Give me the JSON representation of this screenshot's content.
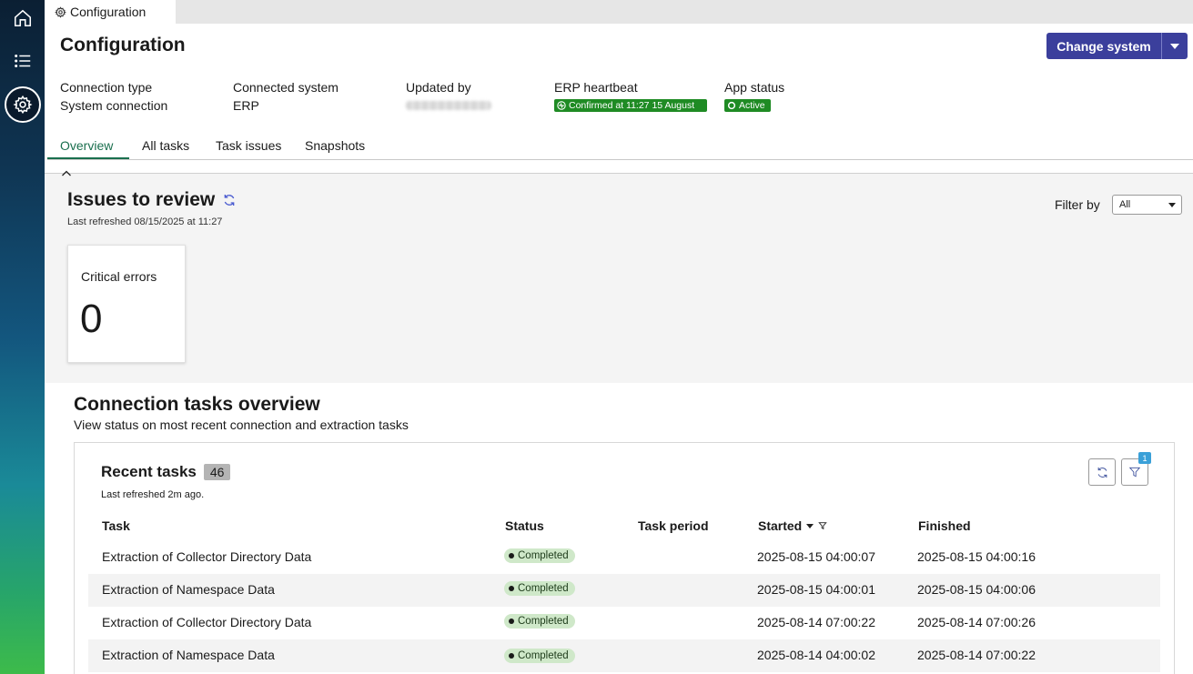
{
  "tab": {
    "label": "Configuration"
  },
  "header": {
    "title": "Configuration",
    "change_button": "Change system"
  },
  "meta": {
    "connection_type_label": "Connection type",
    "connection_type_value": "System connection",
    "connected_system_label": "Connected system",
    "connected_system_value": "ERP",
    "updated_by_label": "Updated by",
    "heartbeat_label": "ERP heartbeat",
    "heartbeat_value": "Confirmed at 11:27 15 August",
    "app_status_label": "App status",
    "app_status_value": "Active",
    "status_color": "#1f8b24"
  },
  "navtabs": [
    "Overview",
    "All tasks",
    "Task issues",
    "Snapshots"
  ],
  "issues": {
    "title": "Issues to review",
    "last_refreshed": "Last refreshed 08/15/2025 at 11:27",
    "filter_label": "Filter by",
    "filter_value": "All",
    "card_label": "Critical errors",
    "card_value": "0"
  },
  "overview": {
    "title": "Connection tasks overview",
    "subtitle": "View status on most recent connection and extraction tasks"
  },
  "recent": {
    "title": "Recent tasks",
    "count": "46",
    "last_refreshed": "Last refreshed 2m ago.",
    "filter_count": "1",
    "columns": [
      "Task",
      "Status",
      "Task period",
      "Started",
      "Finished"
    ],
    "rows": [
      {
        "task": "Extraction of Collector Directory Data",
        "status": "Completed",
        "period": "",
        "started": "2025-08-15 04:00:07",
        "finished": "2025-08-15 04:00:16"
      },
      {
        "task": "Extraction of Namespace Data",
        "status": "Completed",
        "period": "",
        "started": "2025-08-15 04:00:01",
        "finished": "2025-08-15 04:00:06"
      },
      {
        "task": "Extraction of Collector Directory Data",
        "status": "Completed",
        "period": "",
        "started": "2025-08-14 07:00:22",
        "finished": "2025-08-14 07:00:26"
      },
      {
        "task": "Extraction of Namespace Data",
        "status": "Completed",
        "period": "",
        "started": "2025-08-14 04:00:02",
        "finished": "2025-08-14 07:00:22"
      }
    ]
  },
  "colors": {
    "primary": "#3b3f9c",
    "accent_green": "#1a6f4e",
    "success": "#1f8b24",
    "pill_bg": "#cfe8c9"
  }
}
